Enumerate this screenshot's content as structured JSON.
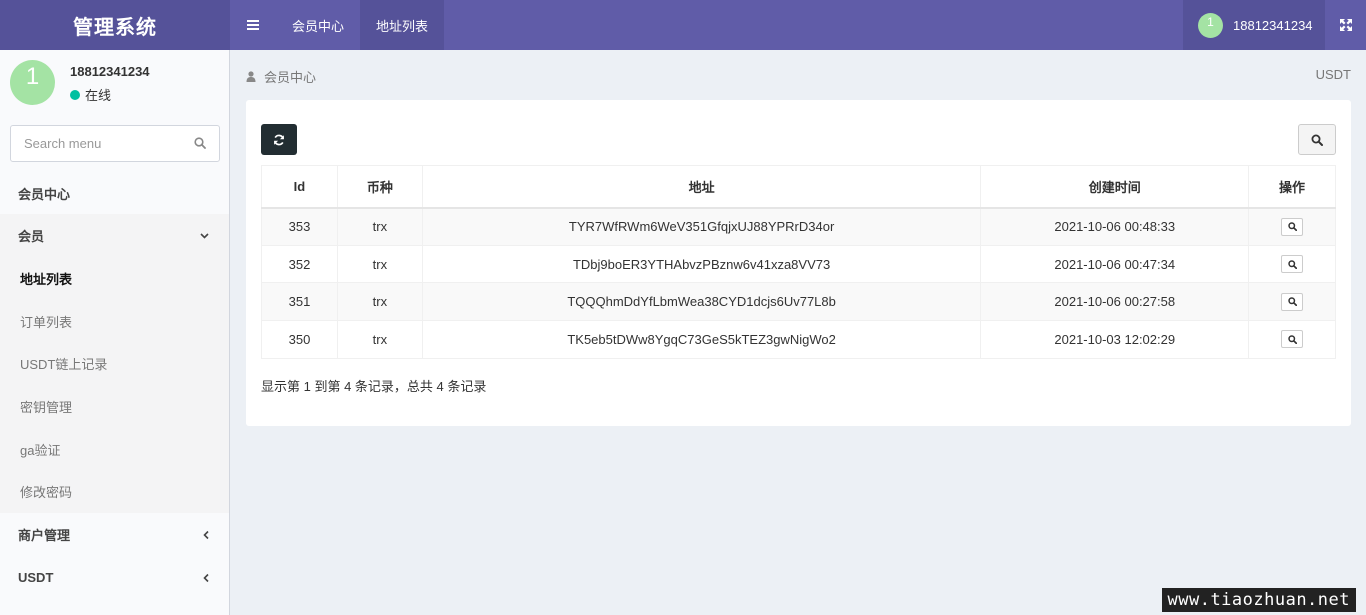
{
  "header": {
    "logo": "管理系统",
    "tabs": [
      {
        "label": "会员中心"
      },
      {
        "label": "地址列表"
      }
    ],
    "user": {
      "avatar_text": "1",
      "name": "18812341234"
    }
  },
  "sidebar": {
    "user": {
      "avatar_text": "1",
      "name": "18812341234",
      "status": "在线"
    },
    "search_placeholder": "Search menu",
    "menu": {
      "header": "会员中心",
      "member": "会员",
      "sub_items": [
        "地址列表",
        "订单列表",
        "USDT链上记录",
        "密钥管理",
        "ga验证",
        "修改密码"
      ],
      "merchant": "商户管理",
      "usdt": "USDT"
    }
  },
  "content": {
    "breadcrumb": "会员中心",
    "breadcrumb_right": "USDT",
    "table": {
      "headers": [
        "Id",
        "币种",
        "地址",
        "创建时间",
        "操作"
      ],
      "rows": [
        {
          "id": "353",
          "coin": "trx",
          "address": "TYR7WfRWm6WeV351GfqjxUJ88YPRrD34or",
          "created": "2021-10-06 00:48:33"
        },
        {
          "id": "352",
          "coin": "trx",
          "address": "TDbj9boER3YTHAbvzPBznw6v41xza8VV73",
          "created": "2021-10-06 00:47:34"
        },
        {
          "id": "351",
          "coin": "trx",
          "address": "TQQQhmDdYfLbmWea38CYD1dcjs6Uv77L8b",
          "created": "2021-10-06 00:27:58"
        },
        {
          "id": "350",
          "coin": "trx",
          "address": "TK5eb5tDWw8YgqC73GeS5kTEZ3gwNigWo2",
          "created": "2021-10-03 12:02:29"
        }
      ]
    },
    "summary": "显示第 1 到第 4 条记录，总共 4 条记录"
  },
  "watermark": "www.tiaozhuan.net"
}
